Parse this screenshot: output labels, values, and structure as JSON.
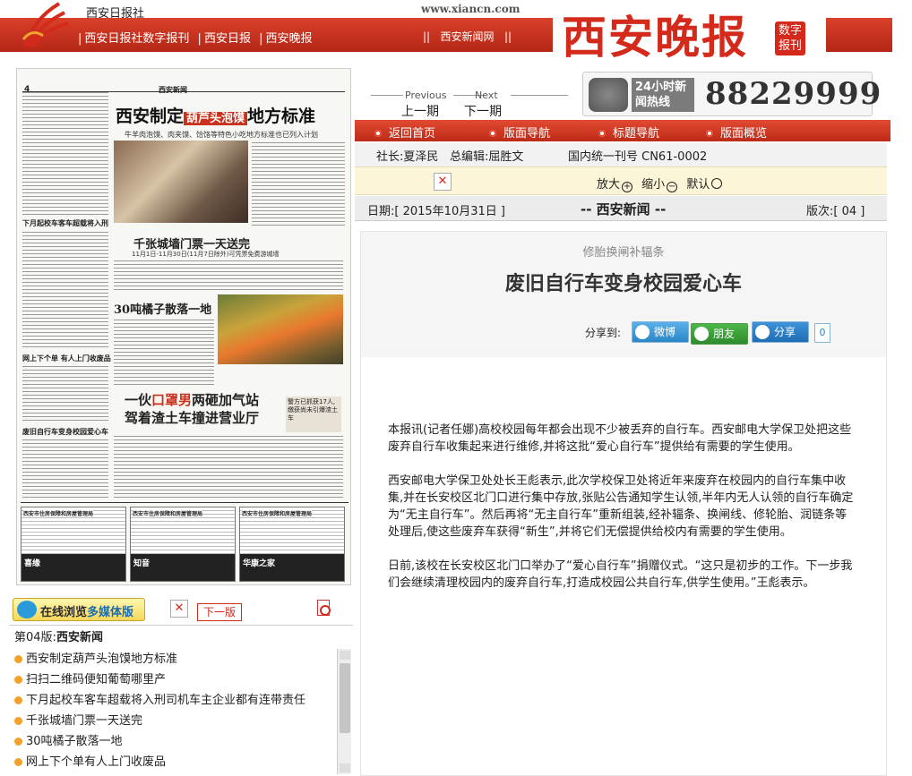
{
  "header": {
    "site_name": "西安日报社",
    "site_url": "www.xiancn.com",
    "nav_links": [
      "西安日报社数字报刊",
      "西安日报",
      "西安晚报"
    ],
    "news_link": "西安新闻网",
    "logo_text": "西安晚报",
    "logo_badge": "数字报刊"
  },
  "newspaper": {
    "page_no": "4",
    "section": "西安新闻",
    "headline_main": "西安制定",
    "headline_highlight": "葫芦头泡馍",
    "headline_tail": "地方标准",
    "headline_sub": "牛羊肉泡馍、肉夹馍、饸饹等特色小吃地方标准也已列入计划",
    "story2": "千张城墙门票一天送完",
    "story2_sub": "11月1日-11月30日(11月7日除外)可凭票免费游城墙",
    "story3": "30吨橘子散落一地",
    "story4_a": "一伙",
    "story4_red": "口罩男",
    "story4_b": "两砸加气站",
    "story4_c": "驾着渣土车撞进营业厅",
    "side_box": "警方已抓获17人,缴获尚未引爆渣土车",
    "left_head1": "下月起校车客车超载将入刑",
    "left_head2": "网上下个单 有人上门收废品",
    "left_head3": "废旧自行车变身校园爱心车",
    "ads": [
      "西安市住房保障和房屋管理局",
      "西安市住房保障和房屋管理局",
      "西安市住房保障和房屋管理局"
    ],
    "ad_strips": [
      "喜缘",
      "知音",
      "华康之家"
    ]
  },
  "tools": {
    "online_label": "在线浏览",
    "online_bold": "多媒体版",
    "next_page": "下一版"
  },
  "toc": {
    "page_label": "第04版:",
    "section": "西安新闻",
    "items": [
      "西安制定葫芦头泡馍地方标准",
      "扫扫二维码便知葡萄哪里产",
      "下月起校车客车超载将入刑司机车主企业都有连带责任",
      "千张城墙门票一天送完",
      "30吨橘子散落一地",
      "网上下个单有人上门收废品"
    ]
  },
  "nav": {
    "previous_label": "Previous",
    "next_label": "Next",
    "previous": "上一期",
    "next": "下一期",
    "hotline_label": "24小时新闻热线",
    "hotline_number": "88229999",
    "menu": [
      "返回首页",
      "版面导航",
      "标题导航",
      "版面概览"
    ]
  },
  "meta": {
    "president": "社长:夏泽民",
    "editor": "总编辑:屈胜文",
    "issn": "国内统一刊号  CN61-0002"
  },
  "zoom": {
    "zoom_in": "放大",
    "zoom_out": "缩小",
    "default": "默认"
  },
  "datebar": {
    "date": "日期:[ 2015年10月31日 ]",
    "section": "--  西安新闻  --",
    "edition": "版次:[ 04 ]"
  },
  "article": {
    "kicker": "修胎换闸补辐条",
    "title": "废旧自行车变身校园爱心车",
    "share_label": "分享到:",
    "share_weibo": "微博",
    "share_pengyou": "朋友",
    "share_fx": "分享",
    "share_count": "0",
    "paragraphs": [
      "本报讯(记者任娜)高校校园每年都会出现不少被丢弃的自行车。西安邮电大学保卫处把这些废弃自行车收集起来进行维修,并将这批“爱心自行车”提供给有需要的学生使用。",
      "西安邮电大学保卫处处长王彪表示,此次学校保卫处将近年来废弃在校园内的自行车集中收集,并在长安校区北门口进行集中存放,张贴公告通知学生认领,半年内无人认领的自行车确定为“无主自行车”。然后再将“无主自行车”重新组装,经补辐条、换闸线、修轮胎、润链条等处理后,使这些废弃车获得“新生”,并将它们无偿提供给校内有需要的学生使用。",
      "日前,该校在长安校区北门口举办了“爱心自行车”捐赠仪式。“这只是初步的工作。下一步我们会继续清理校园内的废弃自行车,打造成校园公共自行车,供学生使用。”王彪表示。"
    ]
  },
  "colors": {
    "brand_red": "#d42a1c",
    "bar_red": "#c9321c",
    "dot_orange": "#f4a12b"
  }
}
